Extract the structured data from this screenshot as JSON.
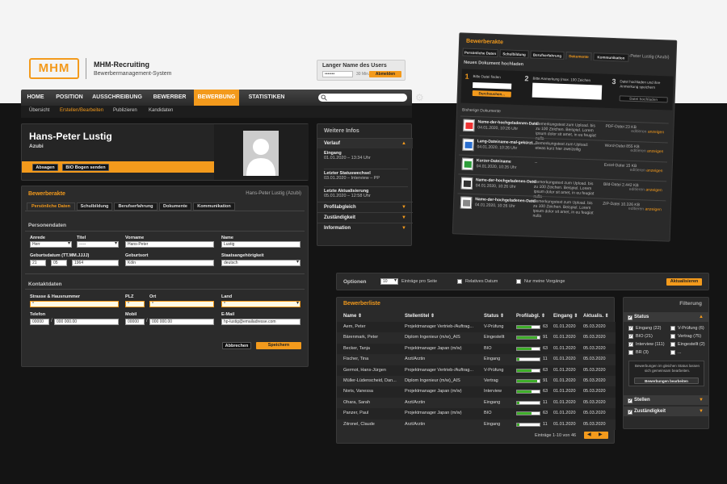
{
  "app": {
    "brand": "MHM-Recruiting",
    "subtitle": "Bewerbermanagement-System",
    "logo_text": "MHM"
  },
  "user": {
    "name": "Langer Name des Users",
    "password_mask": "•••••••",
    "timer": "30 Min.",
    "logout": "Abmelden"
  },
  "nav": {
    "items": [
      "HOME",
      "POSITION",
      "AUSSCHREIBUNG",
      "BEWERBER",
      "BEWERBUNG",
      "STATISTIKEN"
    ],
    "active": "BEWERBUNG"
  },
  "subnav": {
    "items": [
      "Übersicht",
      "Erstellen/Bearbeiten",
      "Publizieren",
      "Kandidaten"
    ],
    "active": "Erstellen/Bearbeiten"
  },
  "candidate": {
    "name": "Hans-Peter Lustig",
    "role": "Azubi",
    "btn_reject": "Absagen",
    "btn_bio": "BIO Bogen senden"
  },
  "akte": {
    "title": "Bewerberakte",
    "who": "Hans-Peter Lustig (Azubi)",
    "tabs": [
      "Persönliche Daten",
      "Schulbildung",
      "Berufserfahrung",
      "Dokumente",
      "Kommunikation"
    ],
    "sec_personal": "Personendaten",
    "labels": {
      "anrede": "Anrede",
      "titel": "Titel",
      "vorname": "Vorname",
      "name": "Name",
      "geburtsdatum": "Geburtsdatum (TT.MM.JJJJ)",
      "geburtsort": "Geburtsort",
      "staat": "Staatsangehörigkeit",
      "strasse": "Strasse & Hausnummer",
      "plz": "PLZ",
      "ort": "Ort",
      "land": "Land",
      "telefon": "Telefon",
      "mobil": "Mobil",
      "email": "E-Mail"
    },
    "values": {
      "anrede": "Herr",
      "titel": "-----",
      "vorname": "Hans-Peter",
      "name": "Lustig",
      "tag": "21",
      "monat": "05",
      "jahr": "1964",
      "geburtsort": "Köln",
      "staat": "deutsch",
      "strasse": "*",
      "plz": "*",
      "ort": "*",
      "land": "*",
      "tel1": "00000",
      "tel2": "000 000.00",
      "mob1": "00000",
      "mob2": "000 000.00",
      "email": "hp-lustig@emailadresse.com"
    },
    "sec_contact": "Kontaktdaten",
    "btn_cancel": "Abbrechen",
    "btn_save": "Speichern"
  },
  "weitere": {
    "title": "Weitere Infos",
    "verlauf": "Verlauf",
    "items": [
      {
        "t": "Eingang",
        "d": "01.01.2020 – 13:34 Uhr"
      },
      {
        "t": "Letzter Statuswechsel",
        "d": "03.01.2020 – Interview – PP"
      },
      {
        "t": "Letzte Aktualisierung",
        "d": "05.01.2020 – 12:58 Uhr"
      }
    ],
    "sections": [
      "Profilabgleich",
      "Zuständigkeit",
      "Information"
    ]
  },
  "docs": {
    "title": "Bewerberakte",
    "who": "Hans-Peter Lustig (Azubi)",
    "tabs": [
      "Persönliche Daten",
      "Schulbildung",
      "Berufserfahrung",
      "Dokumente",
      "Kommunikation"
    ],
    "upload_title": "Neues Dokument hochladen",
    "steps": [
      {
        "n": "1",
        "t": "Bitte Datei finden",
        "b": "Durchsuchen..."
      },
      {
        "n": "2",
        "t": "Bitte Anmerkung (max. 100 Zeichen"
      },
      {
        "n": "3",
        "t": "Datei hochladen und ihre Anmerkung speichern",
        "b": "Datei hochladen"
      }
    ],
    "prev": "Bisherige Dokumente",
    "rows": [
      {
        "n": "Name-der-hochgeladenen-Datei",
        "d": "04.01.2020, 10:26 Uhr",
        "s": "Bemerkungstext zum Upload. bis zu 100 Zeichen. Beispiel. Lorem ipsum dolor sit amet, in eu feugiat nulla",
        "t": "PDF-Datei 23 KB",
        "c": "#e33"
      },
      {
        "n": "Lang-Dateiname-mal-gekürzt...",
        "d": "04.01.2020, 10:26 Uhr",
        "s": "Bemerkungstext zum Upload: etwas kurz hier zweizeilig",
        "t": "Word-Datei 855 KB",
        "c": "#2a6fd0"
      },
      {
        "n": "Kurzer-Dateiname",
        "d": "04.01.2020, 10:26 Uhr",
        "s": "--",
        "t": "Excel-Datei 15 KB",
        "c": "#2d9e3a"
      },
      {
        "n": "Name-der-hochgeladenen-Datei",
        "d": "04.01.2020, 10:26 Uhr",
        "s": "Bemerkungstext zum Upload. bis zu 100 Zeichen. Beispiel. Lorem ipsum dolor sit amet, in eu feugiat nulla",
        "t": "Bild-Datei 2.442 KB",
        "c": "#333"
      },
      {
        "n": "Name-der-hochgeladenen-Datei",
        "d": "04.01.2020, 10:26 Uhr",
        "s": "Bemerkungstext zum Upload. bis zu 100 Zeichen. Beispiel. Lorem ipsum dolor sit amet, in eu feugiat nulla",
        "t": "ZIP-Datei 10.326 KB",
        "c": "#888"
      }
    ],
    "act_edit": "editieren",
    "act_view": "anzeigen"
  },
  "options": {
    "label": "Optionen",
    "per_page": "10",
    "per_page_label": "Einträge pro Seite",
    "rel_date": "Relatives Datum",
    "mine": "Nur meine Vorgänge",
    "refresh": "Aktualisieren"
  },
  "liste": {
    "title": "Bewerberliste",
    "headers": [
      "Name ⇕",
      "Stellentitel ⇕",
      "Status ⇕",
      "Profilabgl. ⇕",
      "Eingang ⇕",
      "Aktualis. ⇕"
    ],
    "rows": [
      {
        "name": "Aem, Peter",
        "stelle": "Projektmanager Vertrieb-/Auftrag...",
        "status": "V-Prüfung",
        "p": 63,
        "ein": "01.01.2020",
        "akt": "05.03.2020"
      },
      {
        "name": "Bärenmark, Peter",
        "stelle": "Diplom Ingenieur (m/w)_AIS",
        "status": "Eingestellt",
        "p": 91,
        "ein": "01.01.2020",
        "akt": "05.03.2020"
      },
      {
        "name": "Becker, Tanja",
        "stelle": "Projektmanager Japan (m/w)",
        "status": "BIO",
        "p": 63,
        "ein": "01.01.2020",
        "akt": "05.03.2020"
      },
      {
        "name": "Fischer, Tina",
        "stelle": "Arzt/Ärztin",
        "status": "Eingang",
        "p": 11,
        "ein": "01.01.2020",
        "akt": "05.03.2020"
      },
      {
        "name": "Germot, Hans-Jürgen",
        "stelle": "Projektmanager Vertrieb-/Auftrag...",
        "status": "V-Prüfung",
        "p": 63,
        "ein": "01.01.2020",
        "akt": "05.03.2020"
      },
      {
        "name": "Müller-Lüdenscheid, Dan...",
        "stelle": "Diplom Ingenieur (m/w)_AIS",
        "status": "Vertrag",
        "p": 91,
        "ein": "01.01.2020",
        "akt": "05.03.2020"
      },
      {
        "name": "Noris, Vanessa",
        "stelle": "Projektmanager Japan (m/w)",
        "status": "Interview",
        "p": 63,
        "ein": "01.01.2020",
        "akt": "05.03.2020"
      },
      {
        "name": "Ohara, Sarah",
        "stelle": "Arzt/Ärztin",
        "status": "Eingang",
        "p": 11,
        "ein": "01.01.2020",
        "akt": "05.03.2020"
      },
      {
        "name": "Panzer, Paul",
        "stelle": "Projektmanager Japan (m/w)",
        "status": "BIO",
        "p": 63,
        "ein": "01.01.2020",
        "akt": "05.03.2020"
      },
      {
        "name": "Zitronel, Claude",
        "stelle": "Arzt/Ärztin",
        "status": "Eingang",
        "p": 11,
        "ein": "01.01.2020",
        "akt": "05.03.2020"
      }
    ],
    "pager": "Einträge 1-10 von 46"
  },
  "filter": {
    "title": "Filterung",
    "status": "Status",
    "items": [
      {
        "l": "Eingang (22)",
        "c": true
      },
      {
        "l": "V-Prüfung (6)",
        "c": false
      },
      {
        "l": "BIO (21)",
        "c": true
      },
      {
        "l": "Vertrag (75)",
        "c": false
      },
      {
        "l": "Interview (111)",
        "c": true
      },
      {
        "l": "Eingestellt (2)",
        "c": false
      },
      {
        "l": "BR (3)",
        "c": false
      },
      {
        "l": "...",
        "c": false
      }
    ],
    "note": "Bewerbungen im gleichen Status lassen sich gemeinsam bearbeiten.",
    "btn": "Bewerbungen bearbeiten",
    "stellen": "Stellen",
    "zust": "Zuständigkeit"
  }
}
